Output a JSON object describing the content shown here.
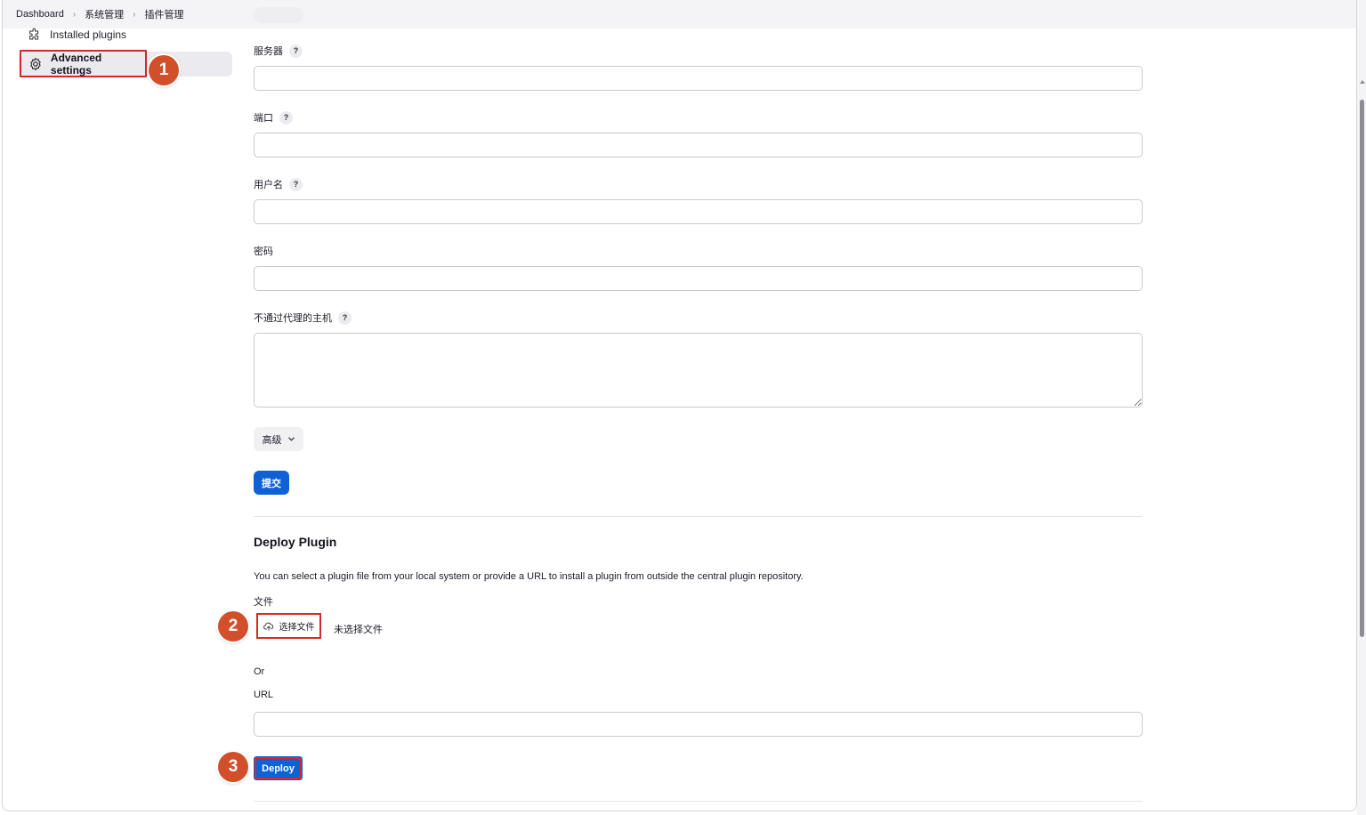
{
  "breadcrumb": {
    "items": [
      "Dashboard",
      "系统管理",
      "插件管理"
    ],
    "separator": ">"
  },
  "sidebar": {
    "items": [
      {
        "label": "Installed plugins",
        "icon": "puzzle-icon"
      },
      {
        "label": "Advanced settings",
        "icon": "gear-icon",
        "active": true
      }
    ]
  },
  "annotations": [
    "1",
    "2",
    "3"
  ],
  "proxy_form": {
    "server_label": "服务器",
    "port_label": "端口",
    "username_label": "用户名",
    "password_label": "密码",
    "no_proxy_hosts_label": "不通过代理的主机",
    "help_symbol": "?",
    "advanced_label": "高级",
    "submit_label": "提交"
  },
  "deploy_plugin": {
    "title": "Deploy Plugin",
    "description": "You can select a plugin file from your local system or provide a URL to install a plugin from outside the central plugin repository.",
    "file_label": "文件",
    "choose_file_label": "选择文件",
    "no_file_label": "未选择文件",
    "or_label": "Or",
    "url_label": "URL",
    "deploy_label": "Deploy"
  },
  "colors": {
    "accent": "#0f62d6",
    "annotation": "#d24f2c",
    "highlight_border": "#d62828"
  }
}
